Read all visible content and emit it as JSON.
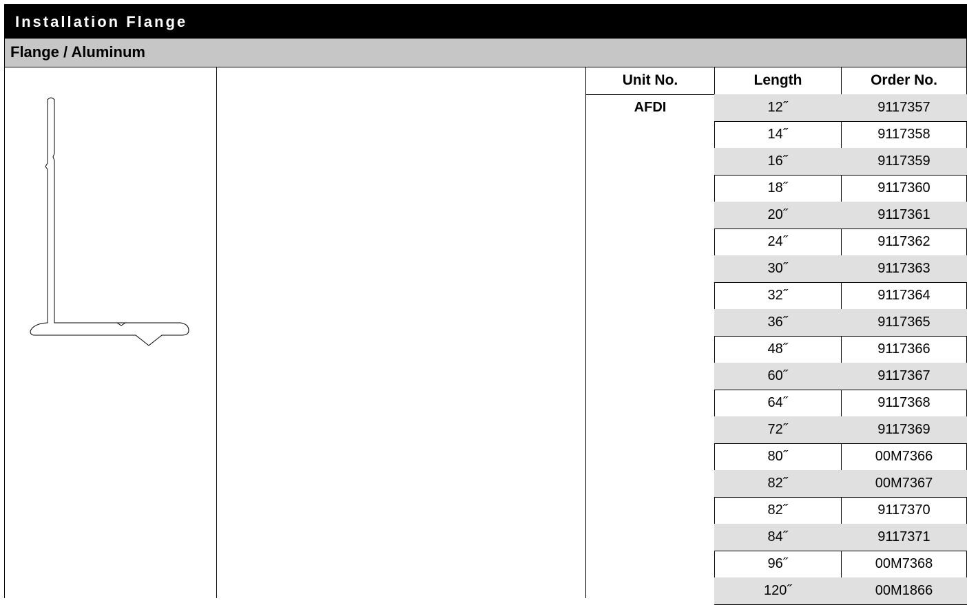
{
  "header": {
    "title": "Installation Flange",
    "subtitle": "Flange / Aluminum"
  },
  "table": {
    "columns": [
      "Unit No.",
      "Length",
      "Order No."
    ],
    "unit_no": "AFDI",
    "rows": [
      {
        "length": "12˝",
        "order_no": "9117357"
      },
      {
        "length": "14˝",
        "order_no": "9117358"
      },
      {
        "length": "16˝",
        "order_no": "9117359"
      },
      {
        "length": "18˝",
        "order_no": "9117360"
      },
      {
        "length": "20˝",
        "order_no": "9117361"
      },
      {
        "length": "24˝",
        "order_no": "9117362"
      },
      {
        "length": "30˝",
        "order_no": "9117363"
      },
      {
        "length": "32˝",
        "order_no": "9117364"
      },
      {
        "length": "36˝",
        "order_no": "9117365"
      },
      {
        "length": "48˝",
        "order_no": "9117366"
      },
      {
        "length": "60˝",
        "order_no": "9117367"
      },
      {
        "length": "64˝",
        "order_no": "9117368"
      },
      {
        "length": "72˝",
        "order_no": "9117369"
      },
      {
        "length": "80˝",
        "order_no": "00M7366"
      },
      {
        "length": "82˝",
        "order_no": "00M7367"
      },
      {
        "length": "82˝",
        "order_no": "9117370"
      },
      {
        "length": "84˝",
        "order_no": "9117371"
      },
      {
        "length": "96˝",
        "order_no": "00M7368"
      },
      {
        "length": "120˝",
        "order_no": "00M1866"
      }
    ]
  },
  "colors": {
    "title_background": "#000000",
    "subtitle_background": "#c6c6c6",
    "row_shade": "#e0e0e0"
  },
  "icons": {
    "profile": "flange-profile-drawing"
  }
}
